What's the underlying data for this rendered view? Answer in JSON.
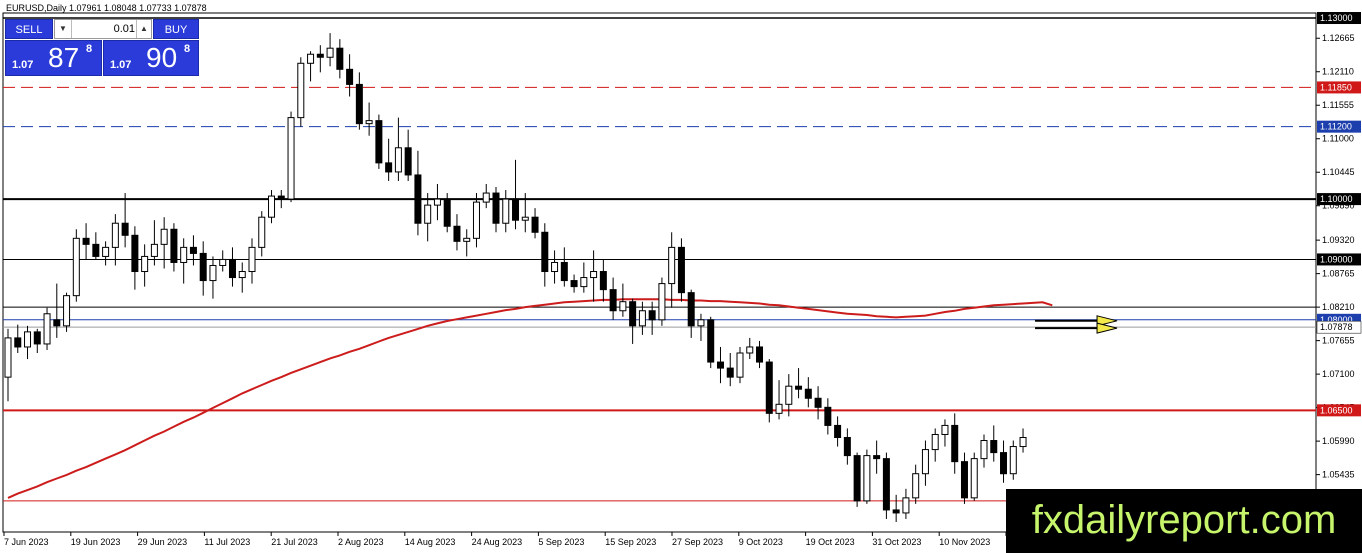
{
  "header": {
    "title": "EURUSD,Daily  1.07961 1.08048 1.07733 1.07878"
  },
  "trade_panel": {
    "sell_label": "SELL",
    "buy_label": "BUY",
    "lot_value": "0.01",
    "lot_down_icon": "triangle-down-icon",
    "lot_up_icon": "triangle-up-icon",
    "sell_small": "1.07",
    "sell_big": "87",
    "sell_sup": "8",
    "buy_small": "1.07",
    "buy_big": "90",
    "buy_sup": "8",
    "color": "#2a3bd9"
  },
  "watermark": {
    "text": "fxdailyreport.com",
    "color": "#c6f56b"
  },
  "chart_data": {
    "type": "candlestick",
    "symbol": "EURUSD",
    "timeframe": "Daily",
    "ylim": [
      1.0465,
      1.1305
    ],
    "price_axis_labels": [
      "1.12665",
      "1.12110",
      "1.11555",
      "1.11000",
      "1.10445",
      "1.09890",
      "1.09320",
      "1.08765",
      "1.08210",
      "1.07655",
      "1.07100",
      "1.06545",
      "1.05990",
      "1.05435"
    ],
    "date_labels": [
      "7 Jun 2023",
      "19 Jun 2023",
      "29 Jun 2023",
      "11 Jul 2023",
      "21 Jul 2023",
      "2 Aug 2023",
      "14 Aug 2023",
      "24 Aug 2023",
      "5 Sep 2023",
      "15 Sep 2023",
      "27 Sep 2023",
      "9 Oct 2023",
      "19 Oct 2023",
      "31 Oct 2023",
      "10 Nov 2023",
      "22 Nov 20"
    ],
    "levels": [
      {
        "price": 1.13,
        "label": "1.13000",
        "color": "#000000",
        "style": "solid",
        "width": 1.5
      },
      {
        "price": 1.1185,
        "label": "1.11850",
        "color": "#d01818",
        "style": "dashed",
        "width": 1
      },
      {
        "price": 1.112,
        "label": "1.11200",
        "color": "#1d3fae",
        "style": "dashed",
        "width": 1
      },
      {
        "price": 1.1,
        "label": "1.10000",
        "color": "#000000",
        "style": "solid",
        "width": 2
      },
      {
        "price": 1.09,
        "label": "1.09000",
        "color": "#000000",
        "style": "solid",
        "width": 1
      },
      {
        "price": 1.08,
        "label": "1.08000",
        "color": "#1d3fae",
        "style": "solid",
        "width": 1
      },
      {
        "price": 1.065,
        "label": "1.06500",
        "color": "#d01818",
        "style": "solid",
        "width": 2
      },
      {
        "price": 1.05,
        "label": "1.05000",
        "color": "#d01818",
        "style": "solid",
        "width": 1
      }
    ],
    "current_price": {
      "price": 1.07878,
      "label": "1.07878"
    },
    "horizontal_line": {
      "price": 1.0821
    },
    "ma_color": "#cc1c1c",
    "ma_200": [
      1.0505,
      1.0512,
      1.0518,
      1.0524,
      1.0531,
      1.0537,
      1.0543,
      1.055,
      1.0556,
      1.0563,
      1.057,
      1.0577,
      1.0584,
      1.0592,
      1.06,
      1.0608,
      1.0615,
      1.0623,
      1.0631,
      1.0638,
      1.0646,
      1.0654,
      1.0662,
      1.067,
      1.0678,
      1.0685,
      1.0692,
      1.0699,
      1.0705,
      1.0712,
      1.0718,
      1.0724,
      1.073,
      1.0736,
      1.0741,
      1.0747,
      1.0752,
      1.0758,
      1.0764,
      1.077,
      1.0775,
      1.078,
      1.0785,
      1.079,
      1.0794,
      1.0798,
      1.0801,
      1.0804,
      1.0807,
      1.081,
      1.0813,
      1.0816,
      1.0818,
      1.0821,
      1.0823,
      1.0825,
      1.0827,
      1.0829,
      1.083,
      1.0831,
      1.0832,
      1.0833,
      1.0833,
      1.0834,
      1.0834,
      1.0834,
      1.0834,
      1.0834,
      1.0833,
      1.0833,
      1.0832,
      1.0832,
      1.0831,
      1.0831,
      1.083,
      1.0829,
      1.0828,
      1.0827,
      1.0825,
      1.0824,
      1.0822,
      1.082,
      1.0818,
      1.0816,
      1.0814,
      1.0812,
      1.081,
      1.0809,
      1.0808,
      1.0806,
      1.0805,
      1.0804,
      1.0805,
      1.0806,
      1.0807,
      1.081,
      1.0813,
      1.0815,
      1.0818,
      1.082,
      1.0822,
      1.0824,
      1.0825,
      1.0826,
      1.0827,
      1.0828,
      1.0829,
      1.0824
    ],
    "candles": [
      {
        "o": 1.0705,
        "h": 1.0785,
        "l": 1.0665,
        "c": 1.077
      },
      {
        "o": 1.077,
        "h": 1.0792,
        "l": 1.0745,
        "c": 1.0755
      },
      {
        "o": 1.0755,
        "h": 1.079,
        "l": 1.0735,
        "c": 1.078
      },
      {
        "o": 1.078,
        "h": 1.0785,
        "l": 1.0745,
        "c": 1.076
      },
      {
        "o": 1.076,
        "h": 1.082,
        "l": 1.075,
        "c": 1.081
      },
      {
        "o": 1.08,
        "h": 1.086,
        "l": 1.077,
        "c": 1.079
      },
      {
        "o": 1.079,
        "h": 1.0845,
        "l": 1.078,
        "c": 1.084
      },
      {
        "o": 1.084,
        "h": 1.095,
        "l": 1.083,
        "c": 1.0935
      },
      {
        "o": 1.0935,
        "h": 1.096,
        "l": 1.09,
        "c": 1.0925
      },
      {
        "o": 1.0925,
        "h": 1.0945,
        "l": 1.09,
        "c": 1.0905
      },
      {
        "o": 1.0905,
        "h": 1.093,
        "l": 1.089,
        "c": 1.092
      },
      {
        "o": 1.092,
        "h": 1.0975,
        "l": 1.089,
        "c": 1.096
      },
      {
        "o": 1.096,
        "h": 1.101,
        "l": 1.092,
        "c": 1.094
      },
      {
        "o": 1.094,
        "h": 1.0955,
        "l": 1.085,
        "c": 1.088
      },
      {
        "o": 1.088,
        "h": 1.0925,
        "l": 1.0855,
        "c": 1.0905
      },
      {
        "o": 1.0905,
        "h": 1.0965,
        "l": 1.089,
        "c": 1.0925
      },
      {
        "o": 1.0925,
        "h": 1.097,
        "l": 1.0885,
        "c": 1.095
      },
      {
        "o": 1.095,
        "h": 1.096,
        "l": 1.088,
        "c": 1.0895
      },
      {
        "o": 1.0895,
        "h": 1.0935,
        "l": 1.086,
        "c": 1.092
      },
      {
        "o": 1.092,
        "h": 1.094,
        "l": 1.089,
        "c": 1.091
      },
      {
        "o": 1.091,
        "h": 1.093,
        "l": 1.084,
        "c": 1.0865
      },
      {
        "o": 1.0865,
        "h": 1.0905,
        "l": 1.0835,
        "c": 1.089
      },
      {
        "o": 1.089,
        "h": 1.0915,
        "l": 1.088,
        "c": 1.09
      },
      {
        "o": 1.09,
        "h": 1.092,
        "l": 1.0855,
        "c": 1.087
      },
      {
        "o": 1.087,
        "h": 1.0895,
        "l": 1.0845,
        "c": 1.088
      },
      {
        "o": 1.088,
        "h": 1.0935,
        "l": 1.086,
        "c": 1.092
      },
      {
        "o": 1.092,
        "h": 1.098,
        "l": 1.0905,
        "c": 1.097
      },
      {
        "o": 1.097,
        "h": 1.1015,
        "l": 1.096,
        "c": 1.1005
      },
      {
        "o": 1.1005,
        "h": 1.1015,
        "l": 1.0985,
        "c": 1.1
      },
      {
        "o": 1.1,
        "h": 1.1145,
        "l": 1.0995,
        "c": 1.1135
      },
      {
        "o": 1.1135,
        "h": 1.1235,
        "l": 1.112,
        "c": 1.1225
      },
      {
        "o": 1.1225,
        "h": 1.1245,
        "l": 1.1195,
        "c": 1.124
      },
      {
        "o": 1.124,
        "h": 1.1255,
        "l": 1.121,
        "c": 1.1235
      },
      {
        "o": 1.1235,
        "h": 1.1275,
        "l": 1.122,
        "c": 1.125
      },
      {
        "o": 1.125,
        "h": 1.1265,
        "l": 1.12,
        "c": 1.1215
      },
      {
        "o": 1.1215,
        "h": 1.124,
        "l": 1.117,
        "c": 1.119
      },
      {
        "o": 1.119,
        "h": 1.121,
        "l": 1.1115,
        "c": 1.1125
      },
      {
        "o": 1.1125,
        "h": 1.116,
        "l": 1.1105,
        "c": 1.113
      },
      {
        "o": 1.113,
        "h": 1.114,
        "l": 1.105,
        "c": 1.106
      },
      {
        "o": 1.106,
        "h": 1.11,
        "l": 1.103,
        "c": 1.1045
      },
      {
        "o": 1.1045,
        "h": 1.1135,
        "l": 1.103,
        "c": 1.1085
      },
      {
        "o": 1.1085,
        "h": 1.1115,
        "l": 1.103,
        "c": 1.104
      },
      {
        "o": 1.104,
        "h": 1.108,
        "l": 1.094,
        "c": 1.096
      },
      {
        "o": 1.096,
        "h": 1.101,
        "l": 1.093,
        "c": 1.099
      },
      {
        "o": 1.099,
        "h": 1.1025,
        "l": 1.0965,
        "c": 1.1
      },
      {
        "o": 1.1,
        "h": 1.101,
        "l": 1.0945,
        "c": 1.0955
      },
      {
        "o": 1.0955,
        "h": 1.0975,
        "l": 1.0915,
        "c": 1.093
      },
      {
        "o": 1.093,
        "h": 1.095,
        "l": 1.0905,
        "c": 1.0935
      },
      {
        "o": 1.0935,
        "h": 1.101,
        "l": 1.092,
        "c": 1.0995
      },
      {
        "o": 1.0995,
        "h": 1.1025,
        "l": 1.0985,
        "c": 1.101
      },
      {
        "o": 1.101,
        "h": 1.102,
        "l": 1.0945,
        "c": 1.096
      },
      {
        "o": 1.096,
        "h": 1.1015,
        "l": 1.0945,
        "c": 1.1
      },
      {
        "o": 1.1,
        "h": 1.1065,
        "l": 1.095,
        "c": 1.0965
      },
      {
        "o": 1.0965,
        "h": 1.101,
        "l": 1.0945,
        "c": 1.097
      },
      {
        "o": 1.097,
        "h": 1.0985,
        "l": 1.0935,
        "c": 1.0945
      },
      {
        "o": 1.0945,
        "h": 1.096,
        "l": 1.0855,
        "c": 1.088
      },
      {
        "o": 1.088,
        "h": 1.0915,
        "l": 1.086,
        "c": 1.0895
      },
      {
        "o": 1.0895,
        "h": 1.092,
        "l": 1.0855,
        "c": 1.0865
      },
      {
        "o": 1.0865,
        "h": 1.0875,
        "l": 1.0845,
        "c": 1.0855
      },
      {
        "o": 1.0855,
        "h": 1.0895,
        "l": 1.0845,
        "c": 1.087
      },
      {
        "o": 1.087,
        "h": 1.0915,
        "l": 1.083,
        "c": 1.088
      },
      {
        "o": 1.088,
        "h": 1.09,
        "l": 1.083,
        "c": 1.085
      },
      {
        "o": 1.085,
        "h": 1.087,
        "l": 1.08,
        "c": 1.0815
      },
      {
        "o": 1.0815,
        "h": 1.086,
        "l": 1.0805,
        "c": 1.083
      },
      {
        "o": 1.083,
        "h": 1.0835,
        "l": 1.076,
        "c": 1.079
      },
      {
        "o": 1.079,
        "h": 1.083,
        "l": 1.0775,
        "c": 1.0815
      },
      {
        "o": 1.0815,
        "h": 1.083,
        "l": 1.0775,
        "c": 1.08
      },
      {
        "o": 1.08,
        "h": 1.087,
        "l": 1.079,
        "c": 1.086
      },
      {
        "o": 1.086,
        "h": 1.0945,
        "l": 1.082,
        "c": 1.092
      },
      {
        "o": 1.092,
        "h": 1.0935,
        "l": 1.083,
        "c": 1.0845
      },
      {
        "o": 1.0845,
        "h": 1.085,
        "l": 1.077,
        "c": 1.079
      },
      {
        "o": 1.079,
        "h": 1.081,
        "l": 1.0765,
        "c": 1.08
      },
      {
        "o": 1.08,
        "h": 1.0805,
        "l": 1.072,
        "c": 1.073
      },
      {
        "o": 1.073,
        "h": 1.0755,
        "l": 1.0695,
        "c": 1.072
      },
      {
        "o": 1.072,
        "h": 1.0745,
        "l": 1.069,
        "c": 1.0705
      },
      {
        "o": 1.0705,
        "h": 1.0755,
        "l": 1.0695,
        "c": 1.0745
      },
      {
        "o": 1.0745,
        "h": 1.077,
        "l": 1.0735,
        "c": 1.0755
      },
      {
        "o": 1.0755,
        "h": 1.0765,
        "l": 1.072,
        "c": 1.073
      },
      {
        "o": 1.073,
        "h": 1.0735,
        "l": 1.063,
        "c": 1.0645
      },
      {
        "o": 1.0645,
        "h": 1.07,
        "l": 1.0635,
        "c": 1.066
      },
      {
        "o": 1.066,
        "h": 1.071,
        "l": 1.064,
        "c": 1.069
      },
      {
        "o": 1.069,
        "h": 1.072,
        "l": 1.067,
        "c": 1.0685
      },
      {
        "o": 1.0685,
        "h": 1.0705,
        "l": 1.0655,
        "c": 1.067
      },
      {
        "o": 1.067,
        "h": 1.069,
        "l": 1.0635,
        "c": 1.0655
      },
      {
        "o": 1.0655,
        "h": 1.067,
        "l": 1.061,
        "c": 1.0625
      },
      {
        "o": 1.0625,
        "h": 1.064,
        "l": 1.059,
        "c": 1.0605
      },
      {
        "o": 1.0605,
        "h": 1.062,
        "l": 1.056,
        "c": 1.0575
      },
      {
        "o": 1.0575,
        "h": 1.058,
        "l": 1.049,
        "c": 1.05
      },
      {
        "o": 1.05,
        "h": 1.0585,
        "l": 1.0495,
        "c": 1.0575
      },
      {
        "o": 1.0575,
        "h": 1.06,
        "l": 1.0545,
        "c": 1.057
      },
      {
        "o": 1.057,
        "h": 1.058,
        "l": 1.047,
        "c": 1.0485
      },
      {
        "o": 1.0485,
        "h": 1.051,
        "l": 1.0465,
        "c": 1.048
      },
      {
        "o": 1.048,
        "h": 1.052,
        "l": 1.047,
        "c": 1.0505
      },
      {
        "o": 1.0505,
        "h": 1.056,
        "l": 1.0495,
        "c": 1.0545
      },
      {
        "o": 1.0545,
        "h": 1.06,
        "l": 1.0525,
        "c": 1.0585
      },
      {
        "o": 1.0585,
        "h": 1.062,
        "l": 1.0565,
        "c": 1.061
      },
      {
        "o": 1.061,
        "h": 1.0635,
        "l": 1.059,
        "c": 1.0625
      },
      {
        "o": 1.0625,
        "h": 1.0645,
        "l": 1.0545,
        "c": 1.0565
      },
      {
        "o": 1.0565,
        "h": 1.058,
        "l": 1.0495,
        "c": 1.0505
      },
      {
        "o": 1.0505,
        "h": 1.058,
        "l": 1.05,
        "c": 1.057
      },
      {
        "o": 1.057,
        "h": 1.061,
        "l": 1.0555,
        "c": 1.06
      },
      {
        "o": 1.06,
        "h": 1.0625,
        "l": 1.0565,
        "c": 1.058
      },
      {
        "o": 1.058,
        "h": 1.06,
        "l": 1.053,
        "c": 1.0545
      },
      {
        "o": 1.0545,
        "h": 1.06,
        "l": 1.0535,
        "c": 1.059
      },
      {
        "o": 1.059,
        "h": 1.062,
        "l": 1.058,
        "c": 1.0605
      }
    ]
  }
}
